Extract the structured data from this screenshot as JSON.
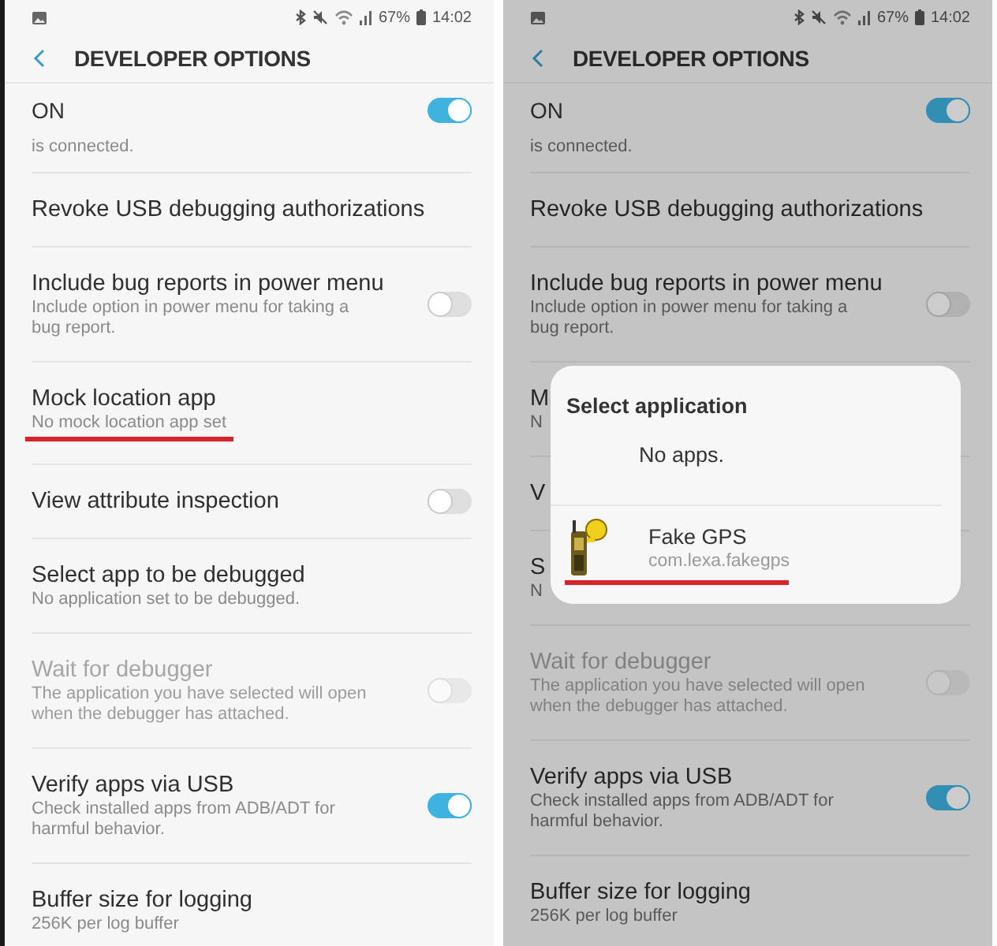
{
  "panels": [
    {
      "dimmed": false,
      "status_bar": {
        "battery": "67%",
        "time": "14:02"
      },
      "header": {
        "title": "DEVELOPER OPTIONS"
      },
      "master": {
        "label": "ON",
        "on": true
      },
      "rows": [
        {
          "kind": "fragment",
          "subtitle": "is connected.",
          "disabled": false,
          "underlined": false
        },
        {
          "kind": "text",
          "title": "Revoke USB debugging authorizations",
          "disabled": false,
          "underlined": false
        },
        {
          "kind": "toggle",
          "title": "Include bug reports in power menu",
          "subtitle": "Include option in power menu for taking a bug report.",
          "on": false,
          "disabled": false,
          "underlined": false
        },
        {
          "kind": "text",
          "title": "Mock location app",
          "subtitle": "No mock location app set",
          "disabled": false,
          "underlined": true
        },
        {
          "kind": "toggle",
          "title": "View attribute inspection",
          "on": false,
          "disabled": false,
          "underlined": false
        },
        {
          "kind": "text",
          "title": "Select app to be debugged",
          "subtitle": "No application set to be debugged.",
          "disabled": false,
          "underlined": false
        },
        {
          "kind": "toggle",
          "title": "Wait for debugger",
          "subtitle": "The application you have selected will open when the debugger has attached.",
          "on": false,
          "disabled": true,
          "underlined": false
        },
        {
          "kind": "toggle",
          "title": "Verify apps via USB",
          "subtitle": "Check installed apps from ADB/ADT for harmful behavior.",
          "on": true,
          "disabled": false,
          "underlined": false
        },
        {
          "kind": "text",
          "title": "Buffer size for logging",
          "subtitle": "256K per log buffer",
          "disabled": false,
          "underlined": false
        }
      ]
    },
    {
      "dimmed": true,
      "status_bar": {
        "battery": "67%",
        "time": "14:02"
      },
      "header": {
        "title": "DEVELOPER OPTIONS"
      },
      "master": {
        "label": "ON",
        "on": true
      },
      "rows": [
        {
          "kind": "fragment",
          "subtitle": "is connected.",
          "disabled": false,
          "underlined": false
        },
        {
          "kind": "text",
          "title": "Revoke USB debugging authorizations",
          "disabled": false,
          "underlined": false
        },
        {
          "kind": "toggle",
          "title": "Include bug reports in power menu",
          "subtitle": "Include option in power menu for taking a bug report.",
          "on": false,
          "disabled": false,
          "underlined": false
        },
        {
          "kind": "text",
          "title": "M",
          "subtitle": "N",
          "disabled": false,
          "underlined": false
        },
        {
          "kind": "text",
          "title": "V",
          "disabled": false,
          "underlined": false
        },
        {
          "kind": "text",
          "title": "S",
          "subtitle": "N",
          "disabled": false,
          "underlined": false
        },
        {
          "kind": "toggle",
          "title": "Wait for debugger",
          "subtitle": "The application you have selected will open when the debugger has attached.",
          "on": false,
          "disabled": true,
          "underlined": false
        },
        {
          "kind": "toggle",
          "title": "Verify apps via USB",
          "subtitle": "Check installed apps from ADB/ADT for harmful behavior.",
          "on": true,
          "disabled": false,
          "underlined": false
        },
        {
          "kind": "text",
          "title": "Buffer size for logging",
          "subtitle": "256K per log buffer",
          "disabled": false,
          "underlined": false
        }
      ],
      "dialog": {
        "title": "Select application",
        "empty_text": "No apps.",
        "apps": [
          {
            "name": "Fake GPS",
            "package": "com.lexa.fakegps",
            "underlined": true
          }
        ]
      }
    }
  ]
}
